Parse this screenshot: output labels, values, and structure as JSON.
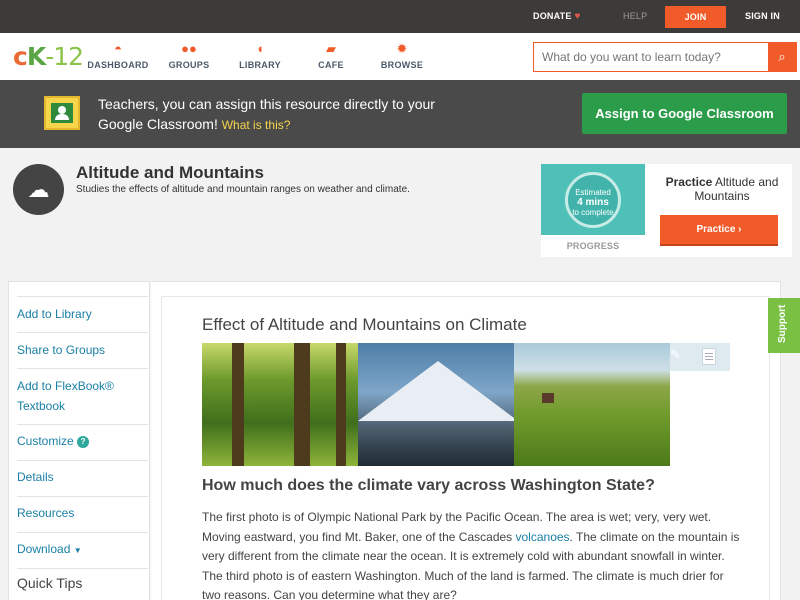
{
  "topbar": {
    "donate": "DONATE",
    "help": "HELP",
    "join": "JOIN",
    "sign_in": "SIGN IN"
  },
  "header": {
    "logo_c": "c",
    "logo_k": "K",
    "logo_rest": "-12",
    "nav": [
      {
        "label": "DASHBOARD",
        "icon": "speedometer-icon"
      },
      {
        "label": "GROUPS",
        "icon": "people-icon"
      },
      {
        "label": "LIBRARY",
        "icon": "book-icon"
      },
      {
        "label": "CAFE",
        "icon": "chat-icon"
      },
      {
        "label": "BROWSE",
        "icon": "lightbulb-icon"
      }
    ],
    "search_placeholder": "What do you want to learn today?"
  },
  "banner": {
    "message": "Teachers, you can assign this resource directly to your Google Classroom!",
    "what_link": "What is this?",
    "assign_button": "Assign to Google Classroom"
  },
  "concept": {
    "title": "Altitude and Mountains",
    "description": "Studies the effects of altitude and mountain ranges on weather and climate."
  },
  "practice": {
    "estimated": "Estimated",
    "mins": "4 mins",
    "to_complete": "to complete",
    "progress_label": "PROGRESS",
    "title_bold": "Practice",
    "title_rest": "Altitude and Mountains",
    "button": "Practice"
  },
  "sidebar": {
    "items": [
      {
        "label": "Add to Library"
      },
      {
        "label": "Share to Groups"
      },
      {
        "label": "Add to FlexBook® Textbook"
      },
      {
        "label": "Customize"
      },
      {
        "label": "Details"
      },
      {
        "label": "Resources"
      },
      {
        "label": "Download"
      }
    ],
    "quick_tips": "Quick Tips"
  },
  "content": {
    "section_title": "Effect of Altitude and Mountains on Climate",
    "question": "How much does the climate vary across Washington State?",
    "para_part1": "The first photo is of Olympic National Park by the Pacific Ocean. The area is wet; very, very wet. Moving eastward, you find Mt. Baker, one of the Cascades ",
    "para_link": "volcanoes",
    "para_part2": ". The climate on the mountain is very different from the climate near the ocean. It is extremely cold with abundant snowfall in winter. The third photo is of eastern Washington. Much of the land is farmed. The climate is much drier for two reasons. Can you determine what they are?"
  },
  "support_tab": "Support",
  "colors": {
    "accent": "#f15a29",
    "link": "#1a7fa5",
    "classroom_green": "#2b9c4a",
    "support_green": "#7ac143"
  }
}
